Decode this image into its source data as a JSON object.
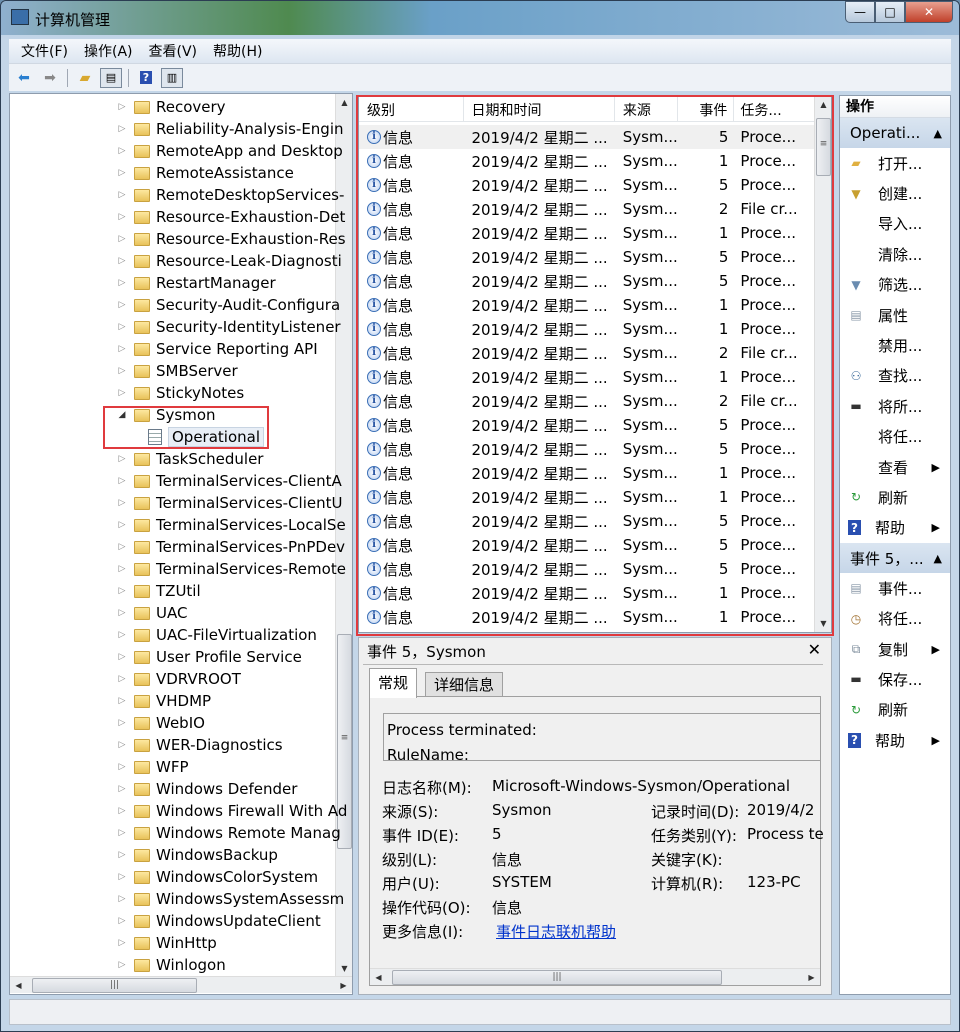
{
  "window": {
    "title": "计算机管理",
    "buttons": [
      "minimize",
      "maximize",
      "close"
    ]
  },
  "menu": [
    "文件(F)",
    "操作(A)",
    "查看(V)",
    "帮助(H)"
  ],
  "toolbar": [
    "back-icon",
    "forward-icon",
    "up-folder-icon",
    "show-hide-tree-icon",
    "help-icon",
    "show-hide-action-pane-icon"
  ],
  "tree": {
    "items": [
      {
        "label": "Recovery",
        "type": "folder",
        "expanded": false
      },
      {
        "label": "Reliability-Analysis-Engin",
        "type": "folder",
        "expanded": false
      },
      {
        "label": "RemoteApp and Desktop",
        "type": "folder",
        "expanded": false
      },
      {
        "label": "RemoteAssistance",
        "type": "folder",
        "expanded": false
      },
      {
        "label": "RemoteDesktopServices-",
        "type": "folder",
        "expanded": false
      },
      {
        "label": "Resource-Exhaustion-Det",
        "type": "folder",
        "expanded": false
      },
      {
        "label": "Resource-Exhaustion-Res",
        "type": "folder",
        "expanded": false
      },
      {
        "label": "Resource-Leak-Diagnosti",
        "type": "folder",
        "expanded": false
      },
      {
        "label": "RestartManager",
        "type": "folder",
        "expanded": false
      },
      {
        "label": "Security-Audit-Configura",
        "type": "folder",
        "expanded": false
      },
      {
        "label": "Security-IdentityListener",
        "type": "folder",
        "expanded": false
      },
      {
        "label": "Service Reporting API",
        "type": "folder",
        "expanded": false
      },
      {
        "label": "SMBServer",
        "type": "folder",
        "expanded": false
      },
      {
        "label": "StickyNotes",
        "type": "folder",
        "expanded": false
      },
      {
        "label": "Sysmon",
        "type": "folder",
        "expanded": true
      },
      {
        "label": "Operational",
        "type": "log",
        "selected": true
      },
      {
        "label": "TaskScheduler",
        "type": "folder",
        "expanded": false
      },
      {
        "label": "TerminalServices-ClientA",
        "type": "folder",
        "expanded": false
      },
      {
        "label": "TerminalServices-ClientU",
        "type": "folder",
        "expanded": false
      },
      {
        "label": "TerminalServices-LocalSe",
        "type": "folder",
        "expanded": false
      },
      {
        "label": "TerminalServices-PnPDev",
        "type": "folder",
        "expanded": false
      },
      {
        "label": "TerminalServices-Remote",
        "type": "folder",
        "expanded": false
      },
      {
        "label": "TZUtil",
        "type": "folder",
        "expanded": false
      },
      {
        "label": "UAC",
        "type": "folder",
        "expanded": false
      },
      {
        "label": "UAC-FileVirtualization",
        "type": "folder",
        "expanded": false
      },
      {
        "label": "User Profile Service",
        "type": "folder",
        "expanded": false
      },
      {
        "label": "VDRVROOT",
        "type": "folder",
        "expanded": false
      },
      {
        "label": "VHDMP",
        "type": "folder",
        "expanded": false
      },
      {
        "label": "WebIO",
        "type": "folder",
        "expanded": false
      },
      {
        "label": "WER-Diagnostics",
        "type": "folder",
        "expanded": false
      },
      {
        "label": "WFP",
        "type": "folder",
        "expanded": false
      },
      {
        "label": "Windows Defender",
        "type": "folder",
        "expanded": false
      },
      {
        "label": "Windows Firewall With Ad",
        "type": "folder",
        "expanded": false
      },
      {
        "label": "Windows Remote Manag",
        "type": "folder",
        "expanded": false
      },
      {
        "label": "WindowsBackup",
        "type": "folder",
        "expanded": false
      },
      {
        "label": "WindowsColorSystem",
        "type": "folder",
        "expanded": false
      },
      {
        "label": "WindowsSystemAssessm",
        "type": "folder",
        "expanded": false
      },
      {
        "label": "WindowsUpdateClient",
        "type": "folder",
        "expanded": false
      },
      {
        "label": "WinHttp",
        "type": "folder",
        "expanded": false
      },
      {
        "label": "Winlogon",
        "type": "folder",
        "expanded": false
      }
    ]
  },
  "events": {
    "columns": [
      "级别",
      "日期和时间",
      "来源",
      "事件 ID",
      "任务..."
    ],
    "rows": [
      [
        "信息",
        "2019/4/2 星期二 ...",
        "Sysm...",
        "5",
        "Proce..."
      ],
      [
        "信息",
        "2019/4/2 星期二 ...",
        "Sysm...",
        "1",
        "Proce..."
      ],
      [
        "信息",
        "2019/4/2 星期二 ...",
        "Sysm...",
        "5",
        "Proce..."
      ],
      [
        "信息",
        "2019/4/2 星期二 ...",
        "Sysm...",
        "2",
        "File cr..."
      ],
      [
        "信息",
        "2019/4/2 星期二 ...",
        "Sysm...",
        "1",
        "Proce..."
      ],
      [
        "信息",
        "2019/4/2 星期二 ...",
        "Sysm...",
        "5",
        "Proce..."
      ],
      [
        "信息",
        "2019/4/2 星期二 ...",
        "Sysm...",
        "5",
        "Proce..."
      ],
      [
        "信息",
        "2019/4/2 星期二 ...",
        "Sysm...",
        "1",
        "Proce..."
      ],
      [
        "信息",
        "2019/4/2 星期二 ...",
        "Sysm...",
        "1",
        "Proce..."
      ],
      [
        "信息",
        "2019/4/2 星期二 ...",
        "Sysm...",
        "2",
        "File cr..."
      ],
      [
        "信息",
        "2019/4/2 星期二 ...",
        "Sysm...",
        "1",
        "Proce..."
      ],
      [
        "信息",
        "2019/4/2 星期二 ...",
        "Sysm...",
        "2",
        "File cr..."
      ],
      [
        "信息",
        "2019/4/2 星期二 ...",
        "Sysm...",
        "5",
        "Proce..."
      ],
      [
        "信息",
        "2019/4/2 星期二 ...",
        "Sysm...",
        "5",
        "Proce..."
      ],
      [
        "信息",
        "2019/4/2 星期二 ...",
        "Sysm...",
        "1",
        "Proce..."
      ],
      [
        "信息",
        "2019/4/2 星期二 ...",
        "Sysm...",
        "1",
        "Proce..."
      ],
      [
        "信息",
        "2019/4/2 星期二 ...",
        "Sysm...",
        "5",
        "Proce..."
      ],
      [
        "信息",
        "2019/4/2 星期二 ...",
        "Sysm...",
        "5",
        "Proce..."
      ],
      [
        "信息",
        "2019/4/2 星期二 ...",
        "Sysm...",
        "5",
        "Proce..."
      ],
      [
        "信息",
        "2019/4/2 星期二 ...",
        "Sysm...",
        "1",
        "Proce..."
      ],
      [
        "信息",
        "2019/4/2 星期二 ...",
        "Sysm...",
        "1",
        "Proce..."
      ]
    ]
  },
  "detail": {
    "title": "事件 5，Sysmon",
    "tabs": [
      "常规",
      "详细信息"
    ],
    "description": [
      "Process terminated:",
      "RuleName:"
    ],
    "fields": {
      "log_name_label": "日志名称(M):",
      "log_name": "Microsoft-Windows-Sysmon/Operational",
      "source_label": "来源(S):",
      "source": "Sysmon",
      "logged_label": "记录时间(D):",
      "logged": "2019/4/2",
      "event_id_label": "事件 ID(E):",
      "event_id": "5",
      "task_label": "任务类别(Y):",
      "task": "Process te",
      "level_label": "级别(L):",
      "level": "信息",
      "keywords_label": "关键字(K):",
      "user_label": "用户(U):",
      "user": "SYSTEM",
      "computer_label": "计算机(R):",
      "computer": "123-PC",
      "opcode_label": "操作代码(O):",
      "opcode": "信息",
      "more_info_label": "更多信息(I):",
      "more_info_link": "事件日志联机帮助"
    }
  },
  "actions": {
    "header": "操作",
    "sections": [
      {
        "title": "Operati...",
        "items": [
          {
            "label": "打开...",
            "icon": "open-folder-icon"
          },
          {
            "label": "创建...",
            "icon": "create-filter-icon"
          },
          {
            "label": "导入...",
            "icon": ""
          },
          {
            "label": "清除...",
            "icon": ""
          },
          {
            "label": "筛选...",
            "icon": "filter-icon"
          },
          {
            "label": "属性",
            "icon": "properties-icon"
          },
          {
            "label": "禁用...",
            "icon": ""
          },
          {
            "label": "查找...",
            "icon": "find-icon"
          },
          {
            "label": "将所...",
            "icon": "save-icon"
          },
          {
            "label": "将任...",
            "icon": ""
          },
          {
            "label": "查看",
            "icon": "",
            "submenu": true
          },
          {
            "label": "刷新",
            "icon": "refresh-icon"
          },
          {
            "label": "帮助",
            "icon": "help-icon",
            "submenu": true
          }
        ]
      },
      {
        "title": "事件 5，...",
        "items": [
          {
            "label": "事件...",
            "icon": "event-properties-icon"
          },
          {
            "label": "将任...",
            "icon": "attach-task-icon"
          },
          {
            "label": "复制",
            "icon": "copy-icon",
            "submenu": true
          },
          {
            "label": "保存...",
            "icon": "save-icon"
          },
          {
            "label": "刷新",
            "icon": "refresh-icon"
          },
          {
            "label": "帮助",
            "icon": "help-icon",
            "submenu": true
          }
        ]
      }
    ]
  },
  "colors": {
    "highlight_box": "#e03a3e",
    "link": "#0033cc",
    "section_header": "#c6d6e8"
  }
}
